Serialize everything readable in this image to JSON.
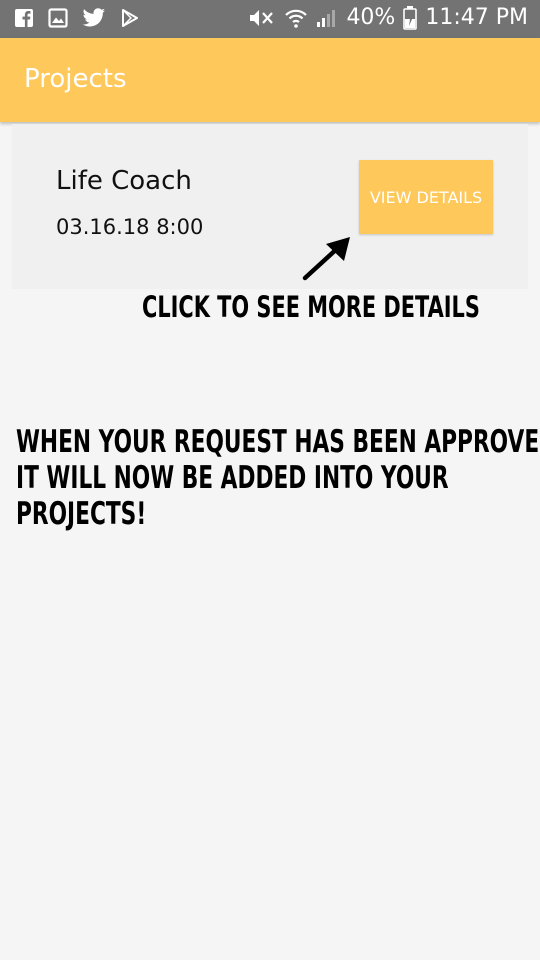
{
  "status_bar": {
    "battery": "40%",
    "time": "11:47 PM",
    "left_icons": [
      "facebook-icon",
      "gallery-icon",
      "twitter-icon",
      "play-store-icon"
    ],
    "right_icons": [
      "mute-icon",
      "wifi-icon",
      "signal-icon",
      "battery-charging-icon"
    ]
  },
  "app_bar": {
    "title": "Projects",
    "color": "#fec85a"
  },
  "project": {
    "name": "Life Coach",
    "date": "03.16.18 8:00",
    "button_label": "VIEW DETAILS"
  },
  "annotations": {
    "arrow_text": "CLICK TO SEE MORE DETAILS",
    "line1": "WHEN YOUR REQUEST HAS BEEN APPROVED,",
    "line2": "IT WILL NOW BE ADDED INTO YOUR",
    "line3": "PROJECTS!"
  }
}
